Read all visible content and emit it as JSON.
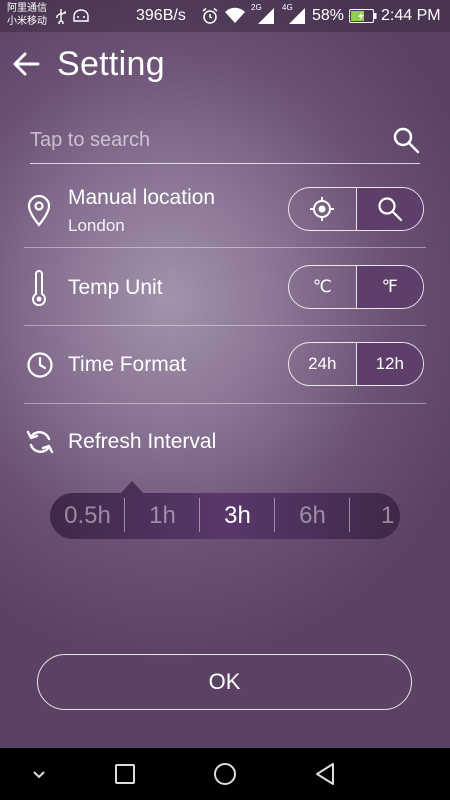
{
  "status_bar": {
    "carrier_line1": "阿里通信",
    "carrier_line2": "小米移动",
    "net_speed": "396B/s",
    "network_2g": "2G",
    "network_4g": "4G",
    "battery_percent": "58%",
    "time": "2:44 PM",
    "icons": [
      "usb-icon",
      "android-icon",
      "alarm-icon",
      "wifi-icon",
      "signal-icon",
      "battery-icon"
    ]
  },
  "header": {
    "title": "Setting",
    "back_icon": "back-arrow-icon"
  },
  "search": {
    "placeholder": "Tap to search",
    "icon": "search-icon"
  },
  "location": {
    "label": "Manual location",
    "value": "London",
    "icon": "location-pin-icon",
    "buttons": [
      "crosshair-icon",
      "search-icon"
    ],
    "active_index": 1
  },
  "temp_unit": {
    "label": "Temp Unit",
    "icon": "thermometer-icon",
    "options": [
      "℃",
      "℉"
    ],
    "active_index": 1
  },
  "time_format": {
    "label": "Time Format",
    "icon": "clock-icon",
    "options": [
      "24h",
      "12h"
    ],
    "active_index": 1
  },
  "refresh": {
    "label": "Refresh Interval",
    "icon": "refresh-icon",
    "options": [
      "0.5h",
      "1h",
      "3h",
      "6h",
      "1"
    ],
    "selected_index": 2
  },
  "ok_label": "OK",
  "navbar": {
    "icons": [
      "collapse-icon",
      "recent-apps-icon",
      "home-icon",
      "back-icon"
    ]
  },
  "colors": {
    "accent": "#5e3f69",
    "slider_bg": "#4a3054",
    "background": "#8a7494"
  }
}
